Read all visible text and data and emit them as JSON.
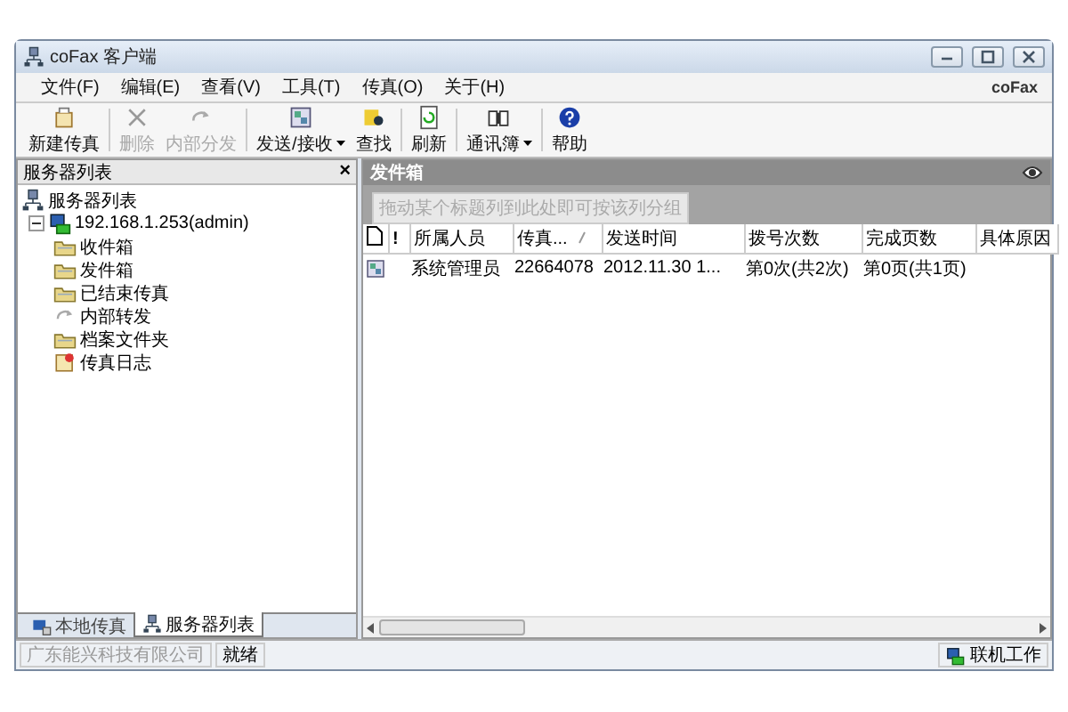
{
  "window": {
    "title": "coFax 客户端",
    "logo": "coFax"
  },
  "menu": [
    "文件(F)",
    "编辑(E)",
    "查看(V)",
    "工具(T)",
    "传真(O)",
    "关于(H)"
  ],
  "toolbar": [
    {
      "label": "新建传真",
      "kind": "new",
      "disabled": false,
      "dropdown": false
    },
    {
      "label": "删除",
      "kind": "delete",
      "disabled": true,
      "dropdown": false
    },
    {
      "label": "内部分发",
      "kind": "forward",
      "disabled": true,
      "dropdown": false
    },
    {
      "label": "发送/接收",
      "kind": "sendrecv",
      "disabled": false,
      "dropdown": true
    },
    {
      "label": "查找",
      "kind": "find",
      "disabled": false,
      "dropdown": false
    },
    {
      "label": "刷新",
      "kind": "refresh",
      "disabled": false,
      "dropdown": false
    },
    {
      "label": "通讯簿",
      "kind": "book",
      "disabled": false,
      "dropdown": true
    },
    {
      "label": "帮助",
      "kind": "help",
      "disabled": false,
      "dropdown": false
    }
  ],
  "left_pane": {
    "title": "服务器列表",
    "close": "×",
    "tree": [
      {
        "label": "服务器列表",
        "kind": "network",
        "children": [
          {
            "label": "192.168.1.253(admin)",
            "kind": "server",
            "expanded": true,
            "children": [
              {
                "label": "收件箱",
                "kind": "folder"
              },
              {
                "label": "发件箱",
                "kind": "folder"
              },
              {
                "label": "已结束传真",
                "kind": "folder"
              },
              {
                "label": "内部转发",
                "kind": "forward"
              },
              {
                "label": "档案文件夹",
                "kind": "folder"
              },
              {
                "label": "传真日志",
                "kind": "log"
              }
            ]
          }
        ]
      }
    ],
    "tabs": [
      {
        "label": "本地传真",
        "kind": "local",
        "selected": false
      },
      {
        "label": "服务器列表",
        "kind": "network",
        "selected": true
      }
    ]
  },
  "right_pane": {
    "title": "发件箱",
    "group_hint": "拖动某个标题列到此处即可按该列分组",
    "columns": [
      {
        "label": "!",
        "sorted": false
      },
      {
        "label": "所属人员",
        "sorted": false
      },
      {
        "label": "传真...",
        "sorted": true
      },
      {
        "label": "发送时间",
        "sorted": false
      },
      {
        "label": "拨号次数",
        "sorted": false
      },
      {
        "label": "完成页数",
        "sorted": false
      },
      {
        "label": "具体原因",
        "sorted": false
      }
    ],
    "rows": [
      {
        "cells": [
          "",
          "系统管理员",
          "22664078",
          "2012.11.30 1...",
          "第0次(共2次)",
          "第0页(共1页)"
        ]
      }
    ]
  },
  "status_bar": {
    "company": "广东能兴科技有限公司",
    "state": "就绪",
    "mode": "联机工作"
  }
}
